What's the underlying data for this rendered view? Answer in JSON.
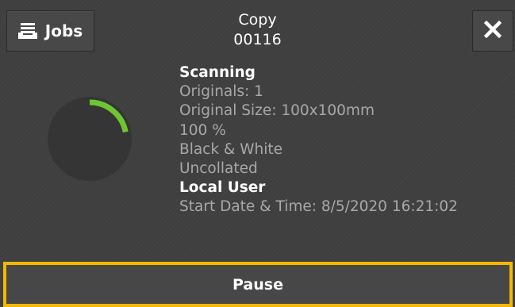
{
  "header": {
    "title": "Copy",
    "job_number": "00116",
    "jobs_label": "Jobs"
  },
  "icons": {
    "jobs": "tray-stack-icon",
    "close": "close-icon"
  },
  "status": {
    "heading": "Scanning",
    "originals": "Originals: 1",
    "original_size": "Original Size: 100x100mm",
    "zoom": "100 %",
    "color_mode": "Black & White",
    "collation": "Uncollated",
    "user": "Local User",
    "start_time": "Start Date & Time: 8/5/2020 16:21:02"
  },
  "progress": {
    "fraction": 0.22
  },
  "footer": {
    "pause_label": "Pause"
  },
  "colors": {
    "progress_arc": "#6ec531",
    "focus_border": "#f5b800",
    "background": "#3f3f3f"
  }
}
